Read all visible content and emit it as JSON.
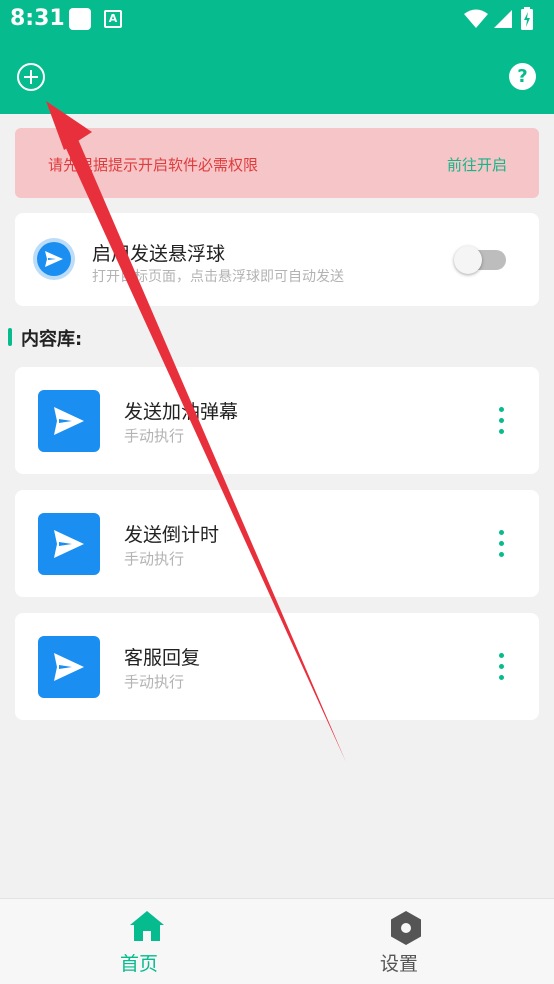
{
  "status_bar": {
    "time": "8:31",
    "notification_a": "A"
  },
  "app_bar": {
    "help_glyph": "?"
  },
  "permission_banner": {
    "text": "请先根据提示开启软件必需权限",
    "action": "前往开启"
  },
  "float_ball": {
    "title": "启用发送悬浮球",
    "subtitle": "打开目标页面，点击悬浮球即可自动发送",
    "enabled": false
  },
  "library": {
    "heading": "内容库:",
    "items": [
      {
        "title": "发送加油弹幕",
        "subtitle": "手动执行"
      },
      {
        "title": "发送倒计时",
        "subtitle": "手动执行"
      },
      {
        "title": "客服回复",
        "subtitle": "手动执行"
      }
    ]
  },
  "bottom_nav": {
    "home": "首页",
    "settings": "设置",
    "active": "home"
  },
  "colors": {
    "primary": "#06bb8d",
    "accent_blue": "#1b8ef2",
    "banner_bg": "#f6c5c8",
    "banner_text": "#e03c3c",
    "arrow": "#e8303c"
  },
  "icons": [
    "add-icon",
    "help-icon",
    "send-icon",
    "more-vert-icon",
    "home-icon",
    "settings-icon",
    "wifi-icon",
    "signal-icon",
    "battery-icon"
  ]
}
